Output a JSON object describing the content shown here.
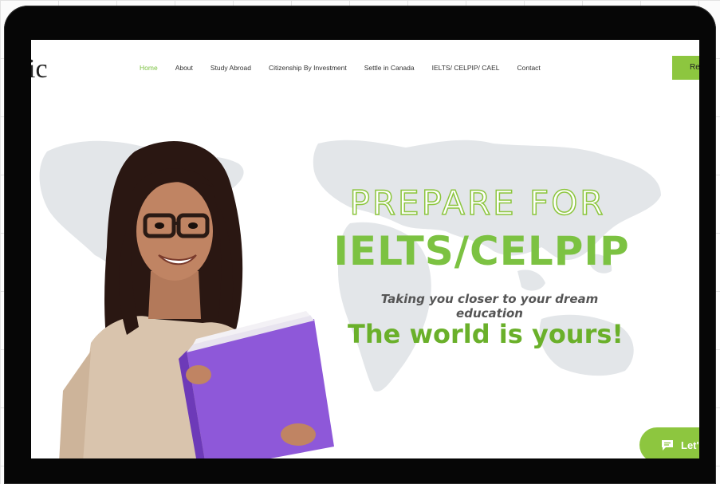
{
  "site": {
    "logo_text": "ic"
  },
  "nav": {
    "items": [
      {
        "label": "Home",
        "active": true
      },
      {
        "label": "About",
        "active": false
      },
      {
        "label": "Study Abroad",
        "active": false
      },
      {
        "label": "Citizenship By Investment",
        "active": false
      },
      {
        "label": "Settle in Canada",
        "active": false
      },
      {
        "label": "IELTS/ CELPIP/ CAEL",
        "active": false
      },
      {
        "label": "Contact",
        "active": false
      }
    ],
    "cta_label": "Re"
  },
  "hero": {
    "title_line1": "PREPARE FOR",
    "title_line2": "IELTS/CELPIP",
    "tagline": "Taking you closer to your dream education",
    "slogan": "The world is yours!"
  },
  "chat": {
    "label": "Let'"
  },
  "colors": {
    "accent": "#8dc63f",
    "accent_dark": "#6ab02a",
    "device": "#060606"
  }
}
